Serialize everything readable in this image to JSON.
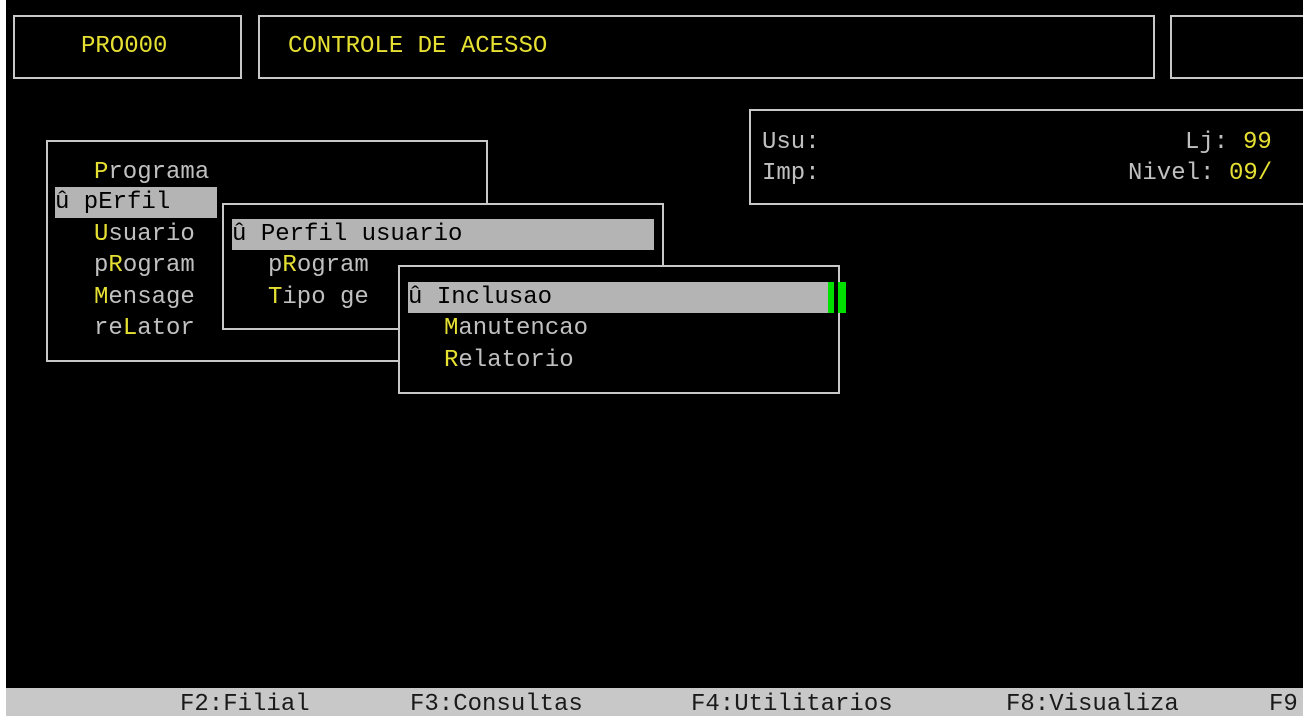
{
  "header": {
    "program_code": "PRO000",
    "title": "CONTROLE DE ACESSO"
  },
  "info_panel": {
    "usu_label": "Usu:",
    "imp_label": "Imp:",
    "lj_label": "Lj:",
    "lj_value": "99",
    "nivel_label": "Nivel:",
    "nivel_value": "09/"
  },
  "main_menu": {
    "items": [
      {
        "label": "Programa",
        "hotkey": "P",
        "selected": false
      },
      {
        "label": "pErfil",
        "hotkey": "E",
        "selected": true,
        "marker": "û"
      },
      {
        "label": "Usuario",
        "hotkey": "U",
        "selected": false
      },
      {
        "label": "pRogram",
        "hotkey": "R",
        "selected": false
      },
      {
        "label": "Mensage",
        "hotkey": "M",
        "selected": false
      },
      {
        "label": "reLator",
        "hotkey": "L",
        "selected": false
      }
    ]
  },
  "perfil_menu": {
    "items": [
      {
        "label": "Perfil usuario",
        "selected": true,
        "marker": "û"
      },
      {
        "label": "pRogram",
        "hotkey": "R",
        "selected": false
      },
      {
        "label": "Tipo ge",
        "hotkey": "T",
        "selected": false
      }
    ]
  },
  "perfil_usuario_menu": {
    "items": [
      {
        "label": "Inclusao",
        "selected": true,
        "marker": "û"
      },
      {
        "label": "Manutencao",
        "hotkey": "M",
        "selected": false
      },
      {
        "label": "Relatorio",
        "hotkey": "R",
        "selected": false
      }
    ]
  },
  "function_keys": [
    {
      "label": "F2:Filial"
    },
    {
      "label": "F3:Consultas"
    },
    {
      "label": "F4:Utilitarios"
    },
    {
      "label": "F8:Visualiza"
    },
    {
      "label": "F9"
    }
  ],
  "colors": {
    "background": "#000000",
    "text": "#c0c0c0",
    "hotkey": "#e6e033",
    "highlight_bg": "#b4b4b4",
    "cursor": "#00e000",
    "statusbar": "#c8c8c8"
  }
}
